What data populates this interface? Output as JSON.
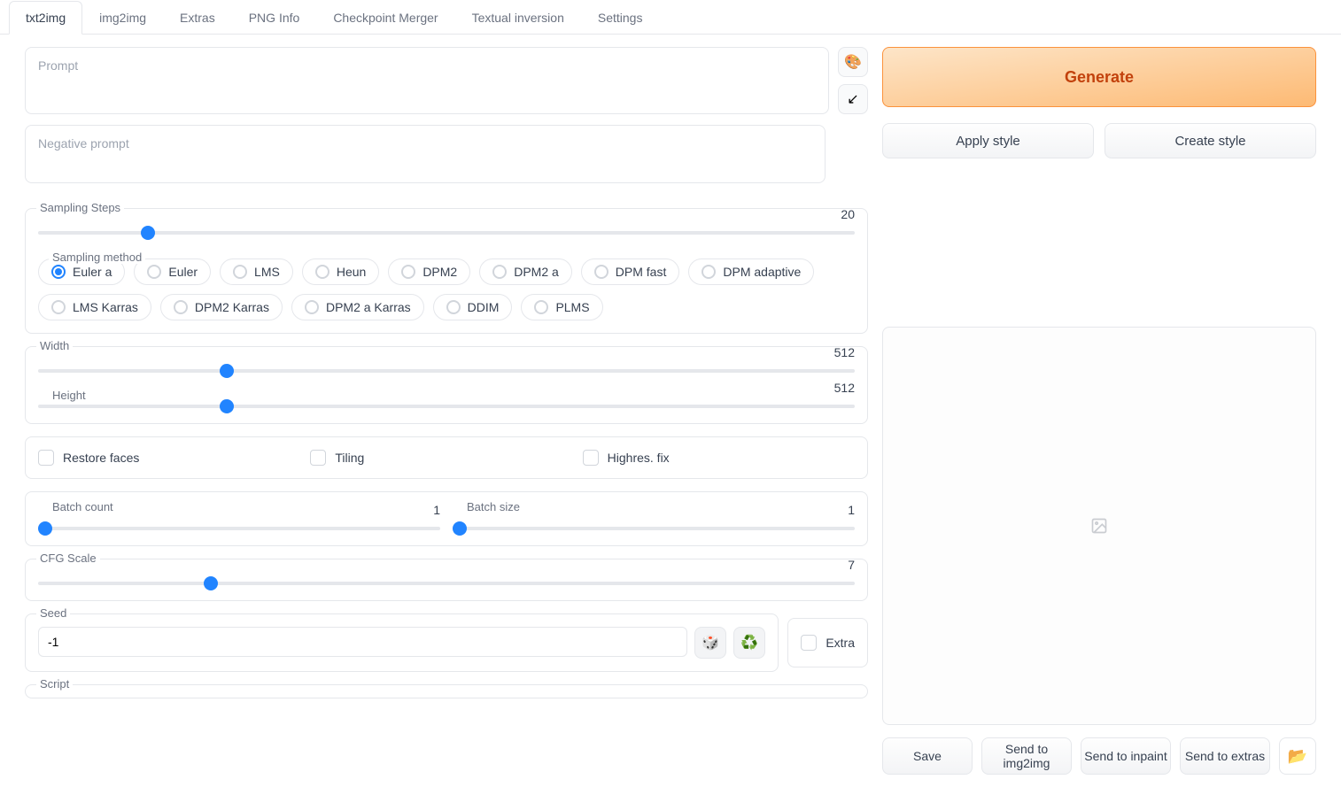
{
  "tabs": [
    "txt2img",
    "img2img",
    "Extras",
    "PNG Info",
    "Checkpoint Merger",
    "Textual inversion",
    "Settings"
  ],
  "activeTab": 0,
  "prompt": {
    "placeholder": "Prompt",
    "value": ""
  },
  "negPrompt": {
    "placeholder": "Negative prompt",
    "value": ""
  },
  "generate": "Generate",
  "applyStyle": "Apply style",
  "createStyle": "Create style",
  "samplingSteps": {
    "label": "Sampling Steps",
    "value": 20,
    "min": 1,
    "max": 150
  },
  "samplingMethod": {
    "label": "Sampling method",
    "options": [
      "Euler a",
      "Euler",
      "LMS",
      "Heun",
      "DPM2",
      "DPM2 a",
      "DPM fast",
      "DPM adaptive",
      "LMS Karras",
      "DPM2 Karras",
      "DPM2 a Karras",
      "DDIM",
      "PLMS"
    ],
    "selected": 0
  },
  "width": {
    "label": "Width",
    "value": 512,
    "min": 64,
    "max": 2048
  },
  "height": {
    "label": "Height",
    "value": 512,
    "min": 64,
    "max": 2048
  },
  "restoreFaces": {
    "label": "Restore faces",
    "checked": false
  },
  "tiling": {
    "label": "Tiling",
    "checked": false
  },
  "highresFix": {
    "label": "Highres. fix",
    "checked": false
  },
  "batchCount": {
    "label": "Batch count",
    "value": 1,
    "min": 1,
    "max": 100
  },
  "batchSize": {
    "label": "Batch size",
    "value": 1,
    "min": 1,
    "max": 8
  },
  "cfg": {
    "label": "CFG Scale",
    "value": 7,
    "min": 1,
    "max": 30
  },
  "seed": {
    "label": "Seed",
    "value": "-1"
  },
  "extra": {
    "label": "Extra",
    "checked": false
  },
  "script": {
    "label": "Script"
  },
  "outputActions": {
    "save": "Save",
    "sendImg2img": "Send to img2img",
    "sendInpaint": "Send to inpaint",
    "sendExtras": "Send to extras"
  }
}
